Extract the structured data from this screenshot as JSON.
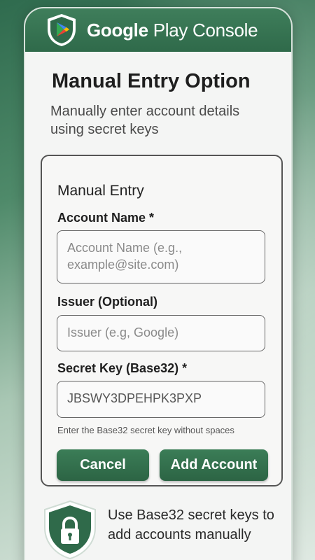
{
  "header": {
    "brand_bold": "Google",
    "brand_rest": " Play Console",
    "logo_icon": "google-play-shield-icon"
  },
  "page": {
    "title": "Manual Entry Option",
    "subtitle": "Manually enter account details using secret keys"
  },
  "form": {
    "heading": "Manual Entry",
    "account_name": {
      "label": "Account Name *",
      "placeholder": "Account Name (e.g., example@site.com)"
    },
    "issuer": {
      "label": "Issuer (Optional)",
      "placeholder": "Issuer (e.g, Google)"
    },
    "secret_key": {
      "label": "Secret Key (Base32) *",
      "value": "JBSWY3DPEHPK3PXP",
      "hint": "Enter the Base32 secret key without spaces"
    },
    "cancel_label": "Cancel",
    "add_label": "Add Account"
  },
  "footer": {
    "icon": "lock-shield-icon",
    "text": "Use Base32 secret keys to add accounts manually"
  },
  "colors": {
    "primary_green": "#2f6a4a",
    "background": "#f4f5f4"
  }
}
